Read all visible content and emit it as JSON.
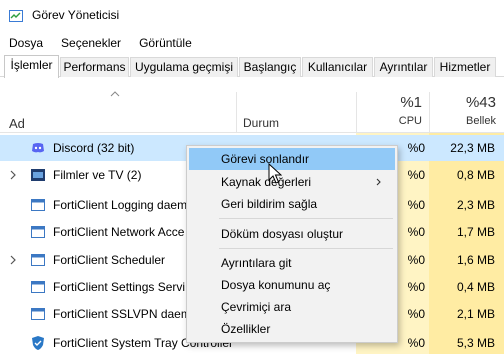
{
  "window": {
    "title": "Görev Yöneticisi"
  },
  "menu": [
    "Dosya",
    "Seçenekler",
    "Görüntüle"
  ],
  "tabs": [
    "İşlemler",
    "Performans",
    "Uygulama geçmişi",
    "Başlangıç",
    "Kullanıcılar",
    "Ayrıntılar",
    "Hizmetler"
  ],
  "columns": {
    "name": "Ad",
    "status": "Durum",
    "cpu_pct": "%1",
    "cpu_label": "CPU",
    "mem_pct": "%43",
    "mem_label": "Bellek"
  },
  "processes": [
    {
      "name": "Discord (32 bit)",
      "cpu": "%0",
      "mem": "22,3 MB",
      "selected": true,
      "expandable": false,
      "icon": "discord-icon"
    },
    {
      "name": "Filmler ve TV (2)",
      "cpu": "%0",
      "mem": "0,8 MB",
      "selected": false,
      "expandable": true,
      "icon": "movies-tv-icon"
    },
    {
      "name": "FortiClient Logging daem",
      "cpu": "%0",
      "mem": "2,3 MB",
      "selected": false,
      "expandable": false,
      "icon": "app-window-icon"
    },
    {
      "name": "FortiClient Network Acce",
      "cpu": "%0",
      "mem": "1,7 MB",
      "selected": false,
      "expandable": false,
      "icon": "app-window-icon"
    },
    {
      "name": "FortiClient Scheduler",
      "cpu": "%0",
      "mem": "1,6 MB",
      "selected": false,
      "expandable": true,
      "icon": "app-window-icon"
    },
    {
      "name": "FortiClient Settings Servi",
      "cpu": "%0",
      "mem": "0,4 MB",
      "selected": false,
      "expandable": false,
      "icon": "app-window-icon"
    },
    {
      "name": "FortiClient SSLVPN daem",
      "cpu": "%0",
      "mem": "2,1 MB",
      "selected": false,
      "expandable": false,
      "icon": "app-window-icon"
    },
    {
      "name": "FortiClient System Tray Controller",
      "cpu": "%0",
      "mem": "5,3 MB",
      "selected": false,
      "expandable": false,
      "icon": "shield-icon"
    }
  ],
  "context_menu": {
    "end_task": "Görevi sonlandır",
    "resource_values": "Kaynak değerleri",
    "feedback": "Geri bildirim sağla",
    "dump_file": "Döküm dosyası oluştur",
    "go_to_details": "Ayrıntılara git",
    "open_file_location": "Dosya konumunu aç",
    "search_online": "Çevrimiçi ara",
    "properties": "Özellikler"
  },
  "colors": {
    "selection": "#cce8ff",
    "menu_highlight": "#91c9f7",
    "cpu_heat": "#fff4c4",
    "mem_heat": "#ffeca3",
    "accent": "#0078d7"
  }
}
